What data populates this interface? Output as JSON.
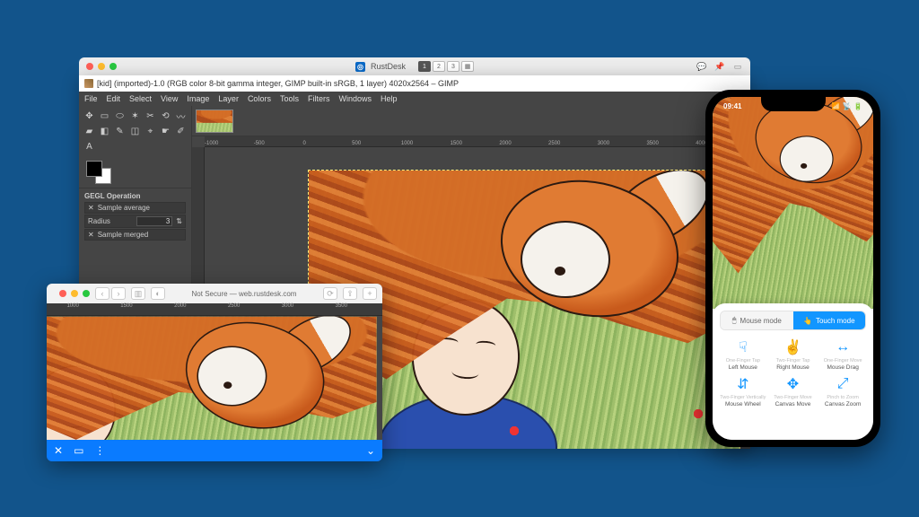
{
  "top_titlebar": {
    "app_name": "RustDesk",
    "tabs": [
      "1",
      "2",
      "3"
    ]
  },
  "gimp": {
    "title": "[kid] (imported)-1.0 (RGB color 8-bit gamma integer, GIMP built-in sRGB, 1 layer) 4020x2564 – GIMP",
    "menu": [
      "File",
      "Edit",
      "Select",
      "View",
      "Image",
      "Layer",
      "Colors",
      "Tools",
      "Filters",
      "Windows",
      "Help"
    ],
    "ruler_marks": [
      "-1000",
      "-500",
      "0",
      "500",
      "1000",
      "1500",
      "2000",
      "2500",
      "3000",
      "3500",
      "4000"
    ],
    "dock": {
      "header": "GEGL Operation",
      "row1": "Sample average",
      "radius_label": "Radius",
      "radius_value": "3",
      "row3": "Sample merged"
    }
  },
  "webwin": {
    "addr": "Not Secure — web.rustdesk.com",
    "ruler_marks": [
      "1000",
      "1500",
      "2000",
      "2500",
      "3000",
      "3500"
    ]
  },
  "phone": {
    "time": "09:41",
    "mode_mouse": "Mouse mode",
    "mode_touch": "Touch mode",
    "gestures": [
      {
        "l1": "One-Finger Tap",
        "l2": "Left Mouse"
      },
      {
        "l1": "Two-Finger Tap",
        "l2": "Right Mouse"
      },
      {
        "l1": "One-Finger Move",
        "l2": "Mouse Drag"
      },
      {
        "l1": "Two-Finger Vertically",
        "l2": "Mouse Wheel"
      },
      {
        "l1": "Two-Finger Move",
        "l2": "Canvas Move"
      },
      {
        "l1": "Pinch to Zoom",
        "l2": "Canvas Zoom"
      }
    ]
  }
}
